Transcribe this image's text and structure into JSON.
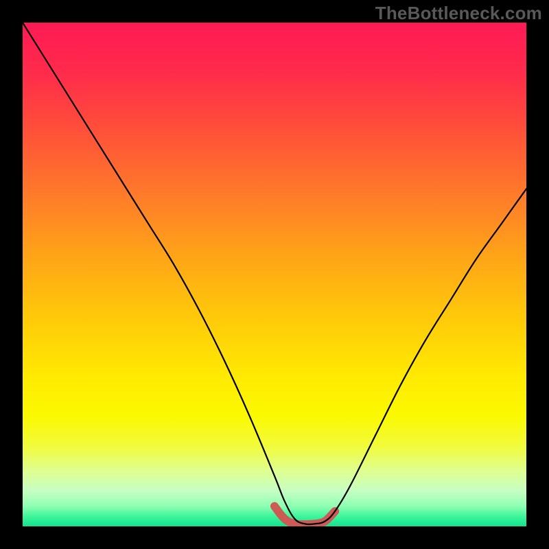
{
  "watermark": "TheBottleneck.com",
  "chart_data": {
    "type": "line",
    "title": "",
    "xlabel": "",
    "ylabel": "",
    "xlim": [
      0,
      100
    ],
    "ylim": [
      0,
      100
    ],
    "legend": false,
    "grid": false,
    "background": "rainbow-gradient (red top → green bottom)",
    "series": [
      {
        "name": "bottleneck-curve",
        "stroke": "#000000",
        "x": [
          0,
          5,
          10,
          15,
          20,
          25,
          30,
          35,
          40,
          45,
          50,
          52,
          54,
          56,
          58,
          60,
          62,
          65,
          70,
          75,
          80,
          85,
          90,
          95,
          100
        ],
        "y": [
          100,
          92,
          84,
          76,
          68,
          60,
          52,
          43,
          33,
          22,
          10,
          5,
          1.5,
          0.5,
          0.5,
          1.0,
          3,
          8,
          18,
          28,
          37,
          45,
          53,
          60,
          67
        ]
      },
      {
        "name": "optimal-range-highlight",
        "stroke": "#cc5a55",
        "x": [
          50,
          52,
          54,
          56,
          58,
          60,
          62
        ],
        "y": [
          4,
          1.5,
          0.5,
          0.4,
          0.5,
          1.0,
          3
        ]
      }
    ],
    "annotations": []
  }
}
